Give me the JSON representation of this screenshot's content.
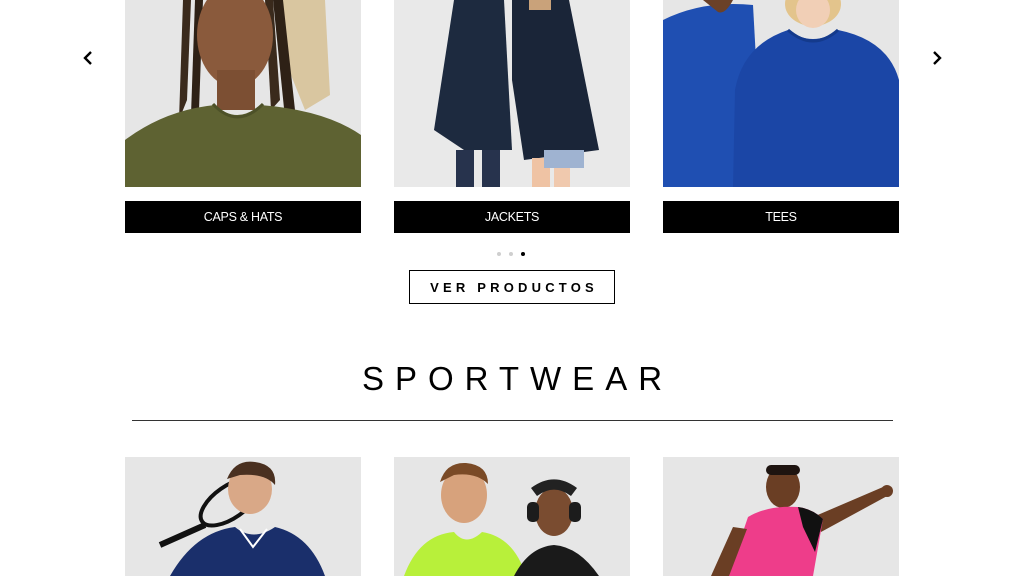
{
  "carousel": {
    "prev_icon": "chevron-left-icon",
    "next_icon": "chevron-right-icon",
    "categories": [
      {
        "label": "CAPS & HATS"
      },
      {
        "label": "JACKETS"
      },
      {
        "label": "TEES"
      }
    ],
    "dots": {
      "count": 3,
      "active_index": 2
    },
    "cta_label": "VER PRODUCTOS"
  },
  "sportwear": {
    "title": "SPORTWEAR"
  },
  "colors": {
    "olive": "#5e6232",
    "navy": "#1d2a3f",
    "royal_blue": "#1f4fb2",
    "neon_yellow": "#b8f03a",
    "pink": "#ee3d8a",
    "grey_bg": "#e6e6e6"
  }
}
